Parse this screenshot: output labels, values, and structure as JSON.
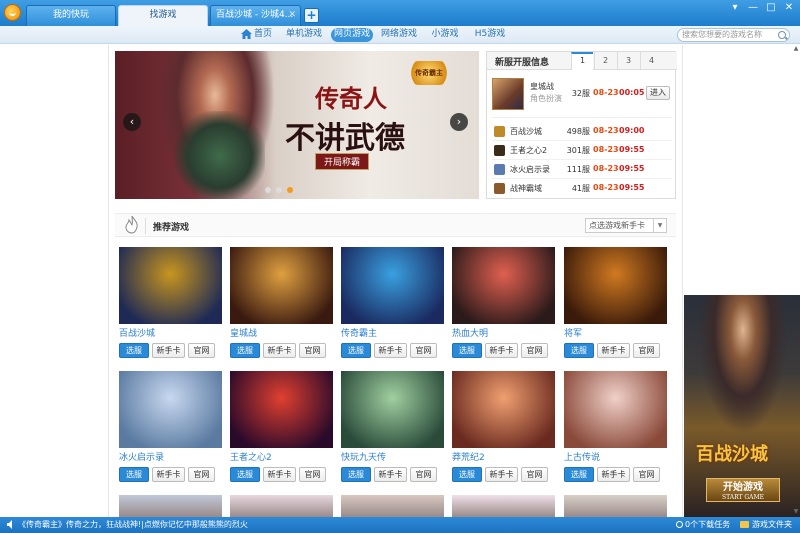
{
  "tabs": [
    {
      "label": "我的快玩"
    },
    {
      "label": "找游戏"
    },
    {
      "label": "百战沙城 - 沙城4..."
    }
  ],
  "tab_add_label": "+",
  "nav": {
    "items": [
      "首页",
      "单机游戏",
      "网页游戏",
      "网络游戏",
      "小游戏",
      "H5游戏"
    ],
    "active": "网页游戏",
    "search_placeholder": "搜索您想要的游戏名称"
  },
  "banner": {
    "title_line1": "传奇人",
    "title_line2": "不讲武德",
    "subtitle": "开局称霸",
    "logo_text": "传奇霸主",
    "prev": "‹",
    "next": "›"
  },
  "server_panel": {
    "title": "新服开服信息",
    "tabs": [
      "1",
      "2",
      "3",
      "4"
    ],
    "featured": {
      "name": "皇城战",
      "type": "角色扮演",
      "server": "32服",
      "date": "08-23",
      "time": "00:05",
      "enter_label": "进入"
    },
    "rows": [
      {
        "name": "百战沙城",
        "server": "498服",
        "date": "08-23",
        "time": "09:00"
      },
      {
        "name": "王者之心2",
        "server": "301服",
        "date": "08-23",
        "time": "09:55"
      },
      {
        "name": "冰火启示录",
        "server": "111服",
        "date": "08-23",
        "time": "09:55"
      },
      {
        "name": "战神霸域",
        "server": "41服",
        "date": "08-23",
        "time": "09:55"
      }
    ]
  },
  "recommend": {
    "title": "推荐游戏",
    "select_value": "点选游戏新手卡",
    "btn_serve": "选服",
    "btn_card": "新手卡",
    "btn_web": "官网",
    "games": [
      {
        "name": "百战沙城",
        "c1": "#c8951e",
        "c2": "#1e2a55"
      },
      {
        "name": "皇城战",
        "c1": "#e0a040",
        "c2": "#3a1a10"
      },
      {
        "name": "传奇霸主",
        "c1": "#3aa0e0",
        "c2": "#1a2a60"
      },
      {
        "name": "热血大明",
        "c1": "#e06050",
        "c2": "#2a1a1a"
      },
      {
        "name": "将军",
        "c1": "#d07a20",
        "c2": "#3a1a0a"
      },
      {
        "name": "冰火启示录",
        "c1": "#c8d8f0",
        "c2": "#5a7aa0"
      },
      {
        "name": "王者之心2",
        "c1": "#e04030",
        "c2": "#2a0a2a"
      },
      {
        "name": "快玩九天传",
        "c1": "#a0d0a0",
        "c2": "#2a4a3a"
      },
      {
        "name": "莽荒纪2",
        "c1": "#f0a070",
        "c2": "#6a2a20"
      },
      {
        "name": "上古传说",
        "c1": "#f0d0c8",
        "c2": "#8a4a3a"
      }
    ]
  },
  "side_ad": {
    "title": "百战沙城",
    "button": "开始游戏",
    "button_sub": "START GAME"
  },
  "status": {
    "message": "《传奇霸主》传奇之力，狂战战神!|点燃你记忆中那般熊熊的烈火",
    "downloads": "0个下载任务",
    "folder": "游戏文件夹"
  },
  "colors": {
    "accent": "#2b8ad8",
    "title_bar": "#1d7ccc",
    "date": "#e24c12"
  }
}
